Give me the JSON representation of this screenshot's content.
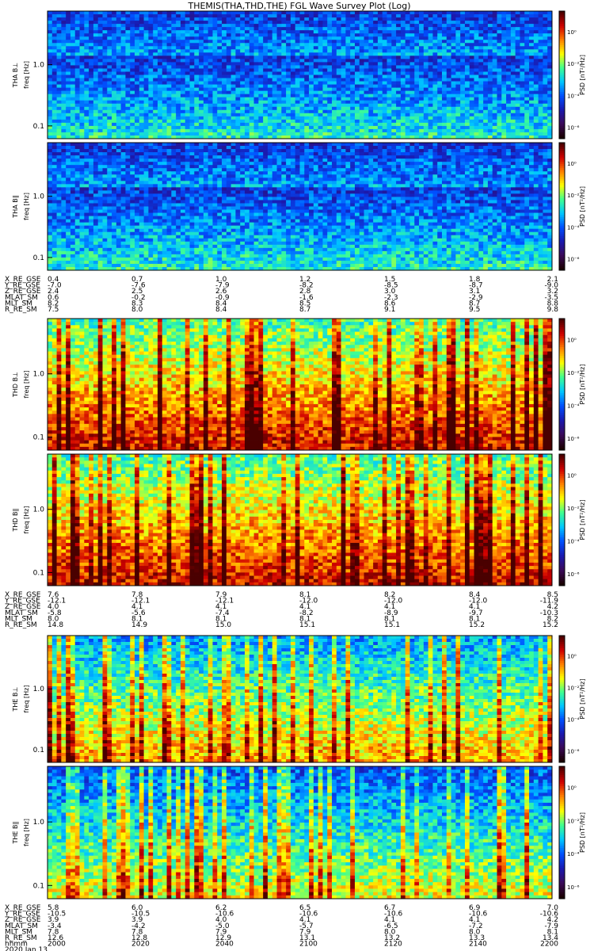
{
  "title": "THEMIS(THA,THD,THE) FGL Wave Survey Plot (Log)",
  "colors": {
    "background": "#ffffff",
    "axis": "#000000",
    "colorbar_stops": [
      "#1a0000",
      "#3b0a5a",
      "#1a1ab0",
      "#0050ff",
      "#00c8ff",
      "#40ff90",
      "#ffff00",
      "#ff8000",
      "#d00000",
      "#4a0000"
    ]
  },
  "chart_data": [
    {
      "type": "heatmap",
      "probe": "THA",
      "panels": [
        {
          "ylabel_probe": "THA B⊥",
          "ylabel_unit": "freq [Hz]",
          "yscale": "log",
          "yticks": [
            "1.0",
            "0.1"
          ],
          "colorbar_label": "PSD [nT²/Hz]",
          "colorbar_ticks": [
            "10⁰",
            "10⁻²",
            "10⁻⁴",
            "10⁻⁶"
          ],
          "level": "low"
        },
        {
          "ylabel_probe": "THA B∥",
          "ylabel_unit": "freq [Hz]",
          "yscale": "log",
          "yticks": [
            "1.0",
            "0.1"
          ],
          "colorbar_label": "PSD [nT²/Hz]",
          "colorbar_ticks": [
            "10⁰",
            "10⁻²",
            "10⁻⁴",
            "10⁻⁶"
          ],
          "level": "low"
        }
      ],
      "ephemeris": {
        "labels": [
          "X_RE_GSE",
          "Y_RE_GSE",
          "Z_RE_GSE",
          "MLAT_SM",
          "MLT_SM",
          "R_RE_SM"
        ],
        "columns": [
          [
            "0.4",
            "-7.0",
            "2.4",
            "0.6",
            "8.2",
            "7.5"
          ],
          [
            "0.7",
            "-7.6",
            "2.5",
            "-0.2",
            "8.3",
            "8.0"
          ],
          [
            "1.0",
            "-7.9",
            "2.6",
            "-0.9",
            "8.4",
            "8.4"
          ],
          [
            "1.2",
            "-8.2",
            "2.8",
            "-1.6",
            "8.5",
            "8.7"
          ],
          [
            "1.5",
            "-8.5",
            "3.0",
            "-2.3",
            "8.6",
            "9.1"
          ],
          [
            "1.8",
            "-8.7",
            "3.1",
            "-2.9",
            "8.7",
            "9.5"
          ],
          [
            "2.1",
            "-9.0",
            "3.2",
            "-3.5",
            "8.8",
            "9.8"
          ]
        ]
      }
    },
    {
      "type": "heatmap",
      "probe": "THD",
      "panels": [
        {
          "ylabel_probe": "THD B⊥",
          "ylabel_unit": "freq [Hz]",
          "yscale": "log",
          "yticks": [
            "1.0",
            "0.1"
          ],
          "colorbar_label": "PSD [nT²/Hz]",
          "colorbar_ticks": [
            "10⁰",
            "10⁻²",
            "10⁻⁴",
            "10⁻⁶"
          ],
          "level": "high"
        },
        {
          "ylabel_probe": "THD B∥",
          "ylabel_unit": "freq [Hz]",
          "yscale": "log",
          "yticks": [
            "1.0",
            "0.1"
          ],
          "colorbar_label": "PSD [nT²/Hz]",
          "colorbar_ticks": [
            "10⁰",
            "10⁻²",
            "10⁻⁴",
            "10⁻⁶"
          ],
          "level": "high"
        }
      ],
      "ephemeris": {
        "labels": [
          "X_RE_GSE",
          "Y_RE_GSE",
          "Z_RE_GSE",
          "MLAT_SM",
          "MLT_SM",
          "R_RE_SM"
        ],
        "columns": [
          [
            "7.6",
            "-12.1",
            "4.0",
            "-5.8",
            "8.0",
            "14.8"
          ],
          [
            "7.8",
            "-12.1",
            "4.1",
            "-5.6",
            "8.1",
            "14.9"
          ],
          [
            "7.9",
            "-12.1",
            "4.1",
            "-7.4",
            "8.1",
            "15.0"
          ],
          [
            "8.1",
            "-12.0",
            "4.1",
            "-8.2",
            "8.1",
            "15.1"
          ],
          [
            "8.2",
            "-12.0",
            "4.1",
            "-8.9",
            "8.1",
            "15.1"
          ],
          [
            "8.4",
            "-12.0",
            "4.1",
            "-9.7",
            "8.1",
            "15.2"
          ],
          [
            "8.5",
            "-11.9",
            "4.2",
            "-10.3",
            "8.2",
            "15.2"
          ]
        ]
      }
    },
    {
      "type": "heatmap",
      "probe": "THE",
      "panels": [
        {
          "ylabel_probe": "THE B⊥",
          "ylabel_unit": "freq [Hz]",
          "yscale": "log",
          "yticks": [
            "1.0",
            "0.1"
          ],
          "colorbar_label": "PSD [nT²/Hz]",
          "colorbar_ticks": [
            "10⁰",
            "10⁻²",
            "10⁻⁴",
            "10⁻⁶"
          ],
          "level": "mid"
        },
        {
          "ylabel_probe": "THE B∥",
          "ylabel_unit": "freq [Hz]",
          "yscale": "log",
          "yticks": [
            "1.0",
            "0.1"
          ],
          "colorbar_label": "PSD [nT²/Hz]",
          "colorbar_ticks": [
            "10⁰",
            "10⁻²",
            "10⁻⁴",
            "10⁻⁶"
          ],
          "level": "mid2"
        }
      ],
      "ephemeris": {
        "labels": [
          "X_RE_GSE",
          "Y_RE_GSE",
          "Z_RE_GSE",
          "MLAT_SM",
          "MLT_SM",
          "R_RE_SM",
          "hhmm",
          "2020 Jan 13"
        ],
        "columns": [
          [
            "5.8",
            "-10.5",
            "3.9",
            "-3.4",
            "7.8",
            "12.6",
            "2000"
          ],
          [
            "6.0",
            "-10.5",
            "3.9",
            "-4.2",
            "7.8",
            "12.8",
            "2020"
          ],
          [
            "6.2",
            "-10.6",
            "4.0",
            "-5.0",
            "7.9",
            "12.9",
            "2040"
          ],
          [
            "6.5",
            "-10.6",
            "4.1",
            "-5.7",
            "7.9",
            "13.1",
            "2100"
          ],
          [
            "6.7",
            "-10.6",
            "4.1",
            "-6.5",
            "8.0",
            "13.2",
            "2120"
          ],
          [
            "6.9",
            "-10.6",
            "4.1",
            "-7.2",
            "8.0",
            "13.3",
            "2140"
          ],
          [
            "7.0",
            "-10.6",
            "4.2",
            "-7.9",
            "8.1",
            "13.4",
            "2200"
          ]
        ]
      }
    }
  ]
}
